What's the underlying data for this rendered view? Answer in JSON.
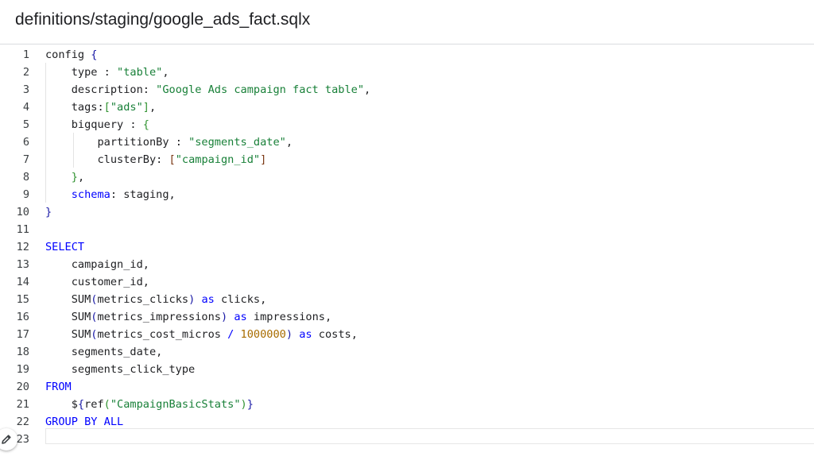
{
  "header": {
    "file_path": "definitions/staging/google_ads_fact.sqlx"
  },
  "editor": {
    "lines": [
      {
        "n": "1",
        "tokens": [
          [
            "plain",
            "config "
          ],
          [
            "br1",
            "{"
          ]
        ]
      },
      {
        "n": "2",
        "tokens": [
          [
            "plain",
            "    type "
          ],
          [
            "punct",
            ": "
          ],
          [
            "str",
            "\"table\""
          ],
          [
            "punct",
            ","
          ]
        ]
      },
      {
        "n": "3",
        "tokens": [
          [
            "plain",
            "    description"
          ],
          [
            "punct",
            ": "
          ],
          [
            "str",
            "\"Google Ads campaign fact table\""
          ],
          [
            "punct",
            ","
          ]
        ]
      },
      {
        "n": "4",
        "tokens": [
          [
            "plain",
            "    tags"
          ],
          [
            "punct",
            ":"
          ],
          [
            "br2",
            "["
          ],
          [
            "str",
            "\"ads\""
          ],
          [
            "br2",
            "]"
          ],
          [
            "punct",
            ","
          ]
        ]
      },
      {
        "n": "5",
        "tokens": [
          [
            "plain",
            "    bigquery "
          ],
          [
            "punct",
            ": "
          ],
          [
            "br2",
            "{"
          ]
        ]
      },
      {
        "n": "6",
        "tokens": [
          [
            "plain",
            "        partitionBy "
          ],
          [
            "punct",
            ": "
          ],
          [
            "str",
            "\"segments_date\""
          ],
          [
            "punct",
            ","
          ]
        ]
      },
      {
        "n": "7",
        "tokens": [
          [
            "plain",
            "        clusterBy"
          ],
          [
            "punct",
            ": "
          ],
          [
            "br3",
            "["
          ],
          [
            "str",
            "\"campaign_id\""
          ],
          [
            "br3",
            "]"
          ]
        ]
      },
      {
        "n": "8",
        "tokens": [
          [
            "plain",
            "    "
          ],
          [
            "br2",
            "}"
          ],
          [
            "punct",
            ","
          ]
        ]
      },
      {
        "n": "9",
        "tokens": [
          [
            "plain",
            "    "
          ],
          [
            "kw",
            "schema"
          ],
          [
            "punct",
            ": "
          ],
          [
            "plain",
            "staging,"
          ]
        ]
      },
      {
        "n": "10",
        "tokens": [
          [
            "br1",
            "}"
          ]
        ]
      },
      {
        "n": "11",
        "tokens": []
      },
      {
        "n": "12",
        "tokens": [
          [
            "kw",
            "SELECT"
          ]
        ]
      },
      {
        "n": "13",
        "tokens": [
          [
            "plain",
            "    campaign_id,"
          ]
        ]
      },
      {
        "n": "14",
        "tokens": [
          [
            "plain",
            "    customer_id,"
          ]
        ]
      },
      {
        "n": "15",
        "tokens": [
          [
            "plain",
            "    SUM"
          ],
          [
            "br1",
            "("
          ],
          [
            "plain",
            "metrics_clicks"
          ],
          [
            "br1",
            ")"
          ],
          [
            "plain",
            " "
          ],
          [
            "kw",
            "as"
          ],
          [
            "plain",
            " clicks,"
          ]
        ]
      },
      {
        "n": "16",
        "tokens": [
          [
            "plain",
            "    SUM"
          ],
          [
            "br1",
            "("
          ],
          [
            "plain",
            "metrics_impressions"
          ],
          [
            "br1",
            ")"
          ],
          [
            "plain",
            " "
          ],
          [
            "kw",
            "as"
          ],
          [
            "plain",
            " impressions,"
          ]
        ]
      },
      {
        "n": "17",
        "tokens": [
          [
            "plain",
            "    SUM"
          ],
          [
            "br1",
            "("
          ],
          [
            "plain",
            "metrics_cost_micros "
          ],
          [
            "kw",
            "/"
          ],
          [
            "plain",
            " "
          ],
          [
            "num",
            "1000000"
          ],
          [
            "br1",
            ")"
          ],
          [
            "plain",
            " "
          ],
          [
            "kw",
            "as"
          ],
          [
            "plain",
            " costs,"
          ]
        ]
      },
      {
        "n": "18",
        "tokens": [
          [
            "plain",
            "    segments_date,"
          ]
        ]
      },
      {
        "n": "19",
        "tokens": [
          [
            "plain",
            "    segments_click_type"
          ]
        ]
      },
      {
        "n": "20",
        "tokens": [
          [
            "kw",
            "FROM"
          ]
        ]
      },
      {
        "n": "21",
        "tokens": [
          [
            "plain",
            "    $"
          ],
          [
            "br1",
            "{"
          ],
          [
            "plain",
            "ref"
          ],
          [
            "br2",
            "("
          ],
          [
            "str",
            "\"CampaignBasicStats\""
          ],
          [
            "br2",
            ")"
          ],
          [
            "br1",
            "}"
          ]
        ]
      },
      {
        "n": "22",
        "tokens": [
          [
            "kw",
            "GROUP BY ALL"
          ]
        ]
      },
      {
        "n": "23",
        "tokens": []
      }
    ]
  },
  "icons": {
    "edit_fab": "pencil-icon",
    "header_action": "more-actions-icon"
  },
  "colors": {
    "keyword": "#0000ff",
    "string": "#188038",
    "number": "#a86c00",
    "bracket_level1": "#1a1aa6",
    "bracket_level2": "#319331",
    "bracket_level3": "#7b3814",
    "accent": "#1a73e8"
  }
}
